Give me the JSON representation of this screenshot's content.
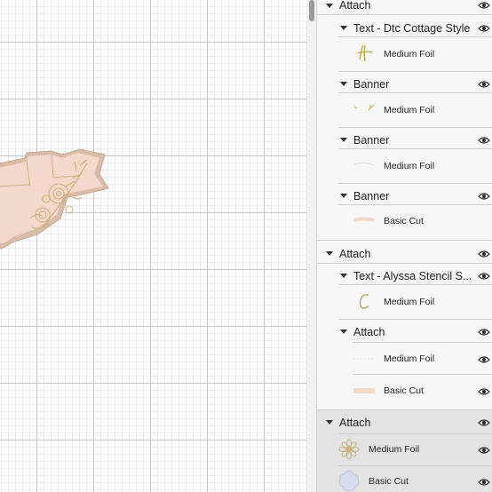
{
  "canvas": {
    "design_colors": {
      "fill": "#f2d9cc",
      "foil": "#c9b27a",
      "cut_outline": "#d7b9a8"
    }
  },
  "layers": {
    "group1": {
      "label": "Attach",
      "text_layer": {
        "label": "Text - Dtc Cottage Style",
        "operation": "Medium Foil"
      },
      "banners": [
        {
          "label": "Banner",
          "operation": "Medium Foil"
        },
        {
          "label": "Banner",
          "operation": "Medium Foil"
        },
        {
          "label": "Banner",
          "operation": "Basic Cut"
        }
      ]
    },
    "group2": {
      "label": "Attach",
      "text_layer": {
        "label": "Text - Alyssa Stencil S...",
        "operation": "Medium Foil"
      },
      "inner_attach": {
        "label": "Attach",
        "items": [
          {
            "operation": "Medium Foil"
          },
          {
            "operation": "Basic Cut"
          }
        ]
      }
    },
    "group3": {
      "label": "Attach",
      "items": [
        {
          "operation": "Medium Foil"
        },
        {
          "operation": "Basic Cut"
        }
      ]
    }
  },
  "icons": {
    "expand": "caret-down-icon",
    "visibility": "eye-icon"
  }
}
